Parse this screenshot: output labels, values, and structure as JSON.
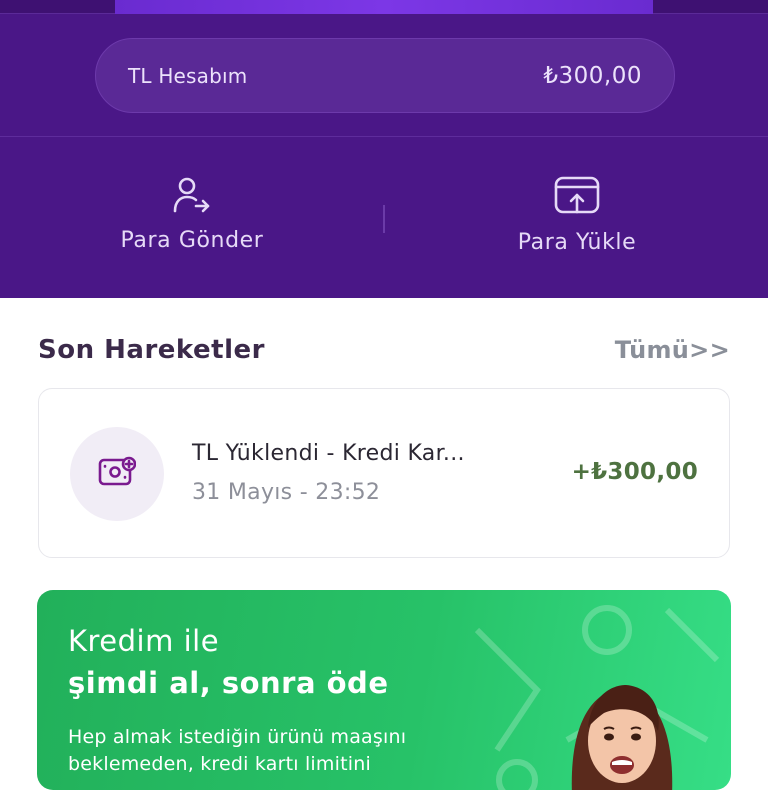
{
  "account": {
    "label": "TL Hesabım",
    "balance": "₺300,00"
  },
  "actions": {
    "send_label": "Para Gönder",
    "send_icon": "user-send-icon",
    "load_label": "Para Yükle",
    "load_icon": "upload-card-icon"
  },
  "recent": {
    "title": "Son Hareketler",
    "see_all": "Tümü>>"
  },
  "transaction": {
    "icon": "money-add-icon",
    "title": "TL Yüklendi - Kredi Kar...",
    "date": "31 Mayıs - 23:52",
    "amount": "+₺300,00"
  },
  "promo": {
    "title_line1": "Kredim ile",
    "title_line2": "şimdi al, sonra öde",
    "body": "Hep almak istediğin ürünü maaşını beklemeden, kredi kartı limitini"
  },
  "colors": {
    "hero": "#4a1787",
    "promo_green": "#27c268",
    "amount_green": "#4e7240"
  }
}
